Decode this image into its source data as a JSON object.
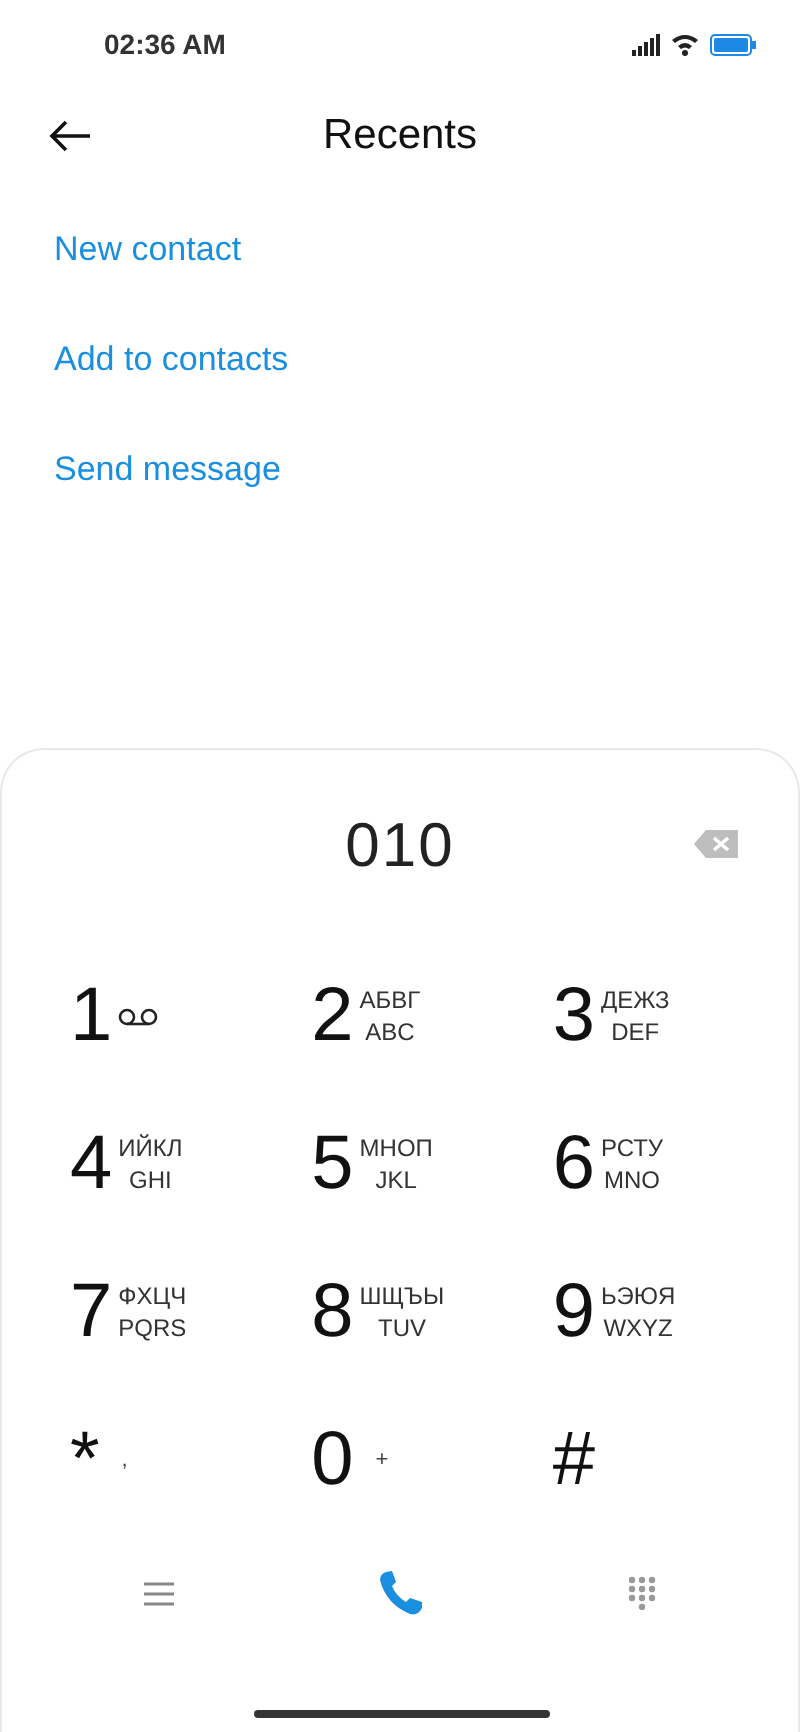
{
  "status_bar": {
    "time": "02:36 AM"
  },
  "header": {
    "title": "Recents"
  },
  "actions": [
    {
      "label": "New contact"
    },
    {
      "label": "Add to contacts"
    },
    {
      "label": "Send message"
    }
  ],
  "dialer": {
    "number": "010",
    "keys": [
      {
        "kind": "voicemail",
        "digit": "1"
      },
      {
        "kind": "letters",
        "digit": "2",
        "top": "АБВГ",
        "bottom": "ABC"
      },
      {
        "kind": "letters",
        "digit": "3",
        "top": "ДЕЖЗ",
        "bottom": "DEF"
      },
      {
        "kind": "letters",
        "digit": "4",
        "top": "ИЙКЛ",
        "bottom": "GHI"
      },
      {
        "kind": "letters",
        "digit": "5",
        "top": "МНОП",
        "bottom": "JKL"
      },
      {
        "kind": "letters",
        "digit": "6",
        "top": "РСТУ",
        "bottom": "MNO"
      },
      {
        "kind": "letters",
        "digit": "7",
        "top": "ФХЦЧ",
        "bottom": "PQRS"
      },
      {
        "kind": "letters",
        "digit": "8",
        "top": "ШЩЪЫ",
        "bottom": "TUV"
      },
      {
        "kind": "letters",
        "digit": "9",
        "top": "ЬЭЮЯ",
        "bottom": "WXYZ"
      },
      {
        "kind": "symbol",
        "digit": "*",
        "side": ","
      },
      {
        "kind": "symbol",
        "digit": "0",
        "side": "+"
      },
      {
        "kind": "plain",
        "digit": "#"
      }
    ]
  }
}
